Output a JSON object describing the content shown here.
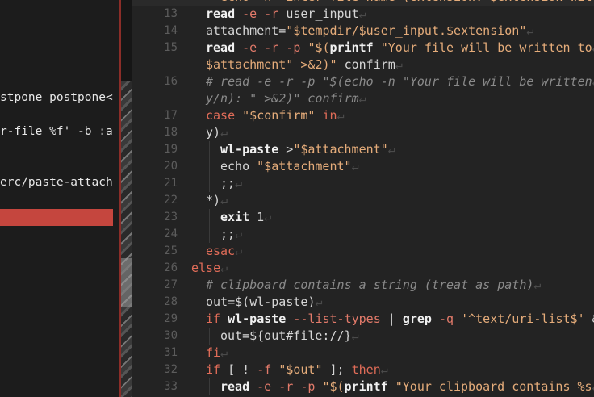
{
  "left_pane": {
    "lines": [
      {
        "text": "stpone postpone<"
      },
      {
        "text": "r-file %f' -b :a"
      },
      {
        "text": "erc/paste-attach"
      }
    ]
  },
  "editor": {
    "newline_glyph": "↵",
    "line_numbers": [
      "13",
      "14",
      "15",
      "16",
      "17",
      "18",
      "19",
      "20",
      "21",
      "22",
      "23",
      "24",
      "25",
      "26",
      "27",
      "28",
      "29",
      "30",
      "31",
      "32",
      "33"
    ],
    "top_partial_text": "echo -n \"Enter file name (extension: $extension will b",
    "lines": [
      {
        "num": "13",
        "tokens": [
          {
            "t": "read",
            "c": "fn"
          },
          {
            "t": " ",
            "c": ""
          },
          {
            "t": "-e",
            "c": "flag"
          },
          {
            "t": " ",
            "c": ""
          },
          {
            "t": "-r",
            "c": "flag"
          },
          {
            "t": " user_input",
            "c": ""
          }
        ]
      },
      {
        "num": "14",
        "tokens": [
          {
            "t": "attachment=",
            "c": ""
          },
          {
            "t": "\"",
            "c": "str"
          },
          {
            "t": "$tempdir",
            "c": "var"
          },
          {
            "t": "/",
            "c": "str"
          },
          {
            "t": "$user_input",
            "c": "var"
          },
          {
            "t": ".",
            "c": "str"
          },
          {
            "t": "$extension",
            "c": "var"
          },
          {
            "t": "\"",
            "c": "str"
          }
        ]
      },
      {
        "num": "15",
        "tokens": [
          {
            "t": "read",
            "c": "fn"
          },
          {
            "t": " ",
            "c": ""
          },
          {
            "t": "-e",
            "c": "flag"
          },
          {
            "t": " ",
            "c": ""
          },
          {
            "t": "-r",
            "c": "flag"
          },
          {
            "t": " ",
            "c": ""
          },
          {
            "t": "-p",
            "c": "flag"
          },
          {
            "t": " ",
            "c": ""
          },
          {
            "t": "\"$(",
            "c": "str"
          },
          {
            "t": "printf",
            "c": "fn"
          },
          {
            "t": " \"Your file will be written to",
            "c": "str"
          }
        ]
      },
      {
        "num": "",
        "tokens": [
          {
            "t": "$attachment\" >&2)\"",
            "c": "str"
          },
          {
            "t": " confirm",
            "c": ""
          }
        ]
      },
      {
        "num": "16",
        "tokens": [
          {
            "t": "# read -e -r -p \"$(echo -n \"Your file will be written",
            "c": "cmt"
          }
        ]
      },
      {
        "num": "",
        "tokens": [
          {
            "t": "y/n): \" >&2)\" confirm",
            "c": "cmt"
          }
        ]
      },
      {
        "num": "17",
        "tokens": [
          {
            "t": "case",
            "c": "kw"
          },
          {
            "t": " ",
            "c": ""
          },
          {
            "t": "\"$confirm\"",
            "c": "str"
          },
          {
            "t": " ",
            "c": ""
          },
          {
            "t": "in",
            "c": "kw"
          }
        ]
      },
      {
        "num": "18",
        "tokens": [
          {
            "t": "y)",
            "c": ""
          }
        ]
      },
      {
        "num": "19",
        "tokens": [
          {
            "t": "wl-paste",
            "c": "fn"
          },
          {
            "t": " >",
            "c": ""
          },
          {
            "t": "\"$attachment\"",
            "c": "str"
          }
        ]
      },
      {
        "num": "20",
        "tokens": [
          {
            "t": "echo",
            "c": ""
          },
          {
            "t": " ",
            "c": ""
          },
          {
            "t": "\"$attachment\"",
            "c": "str"
          }
        ]
      },
      {
        "num": "21",
        "tokens": [
          {
            "t": ";;",
            "c": ""
          }
        ]
      },
      {
        "num": "22",
        "tokens": [
          {
            "t": "*)",
            "c": ""
          }
        ]
      },
      {
        "num": "23",
        "tokens": [
          {
            "t": "exit",
            "c": "fn"
          },
          {
            "t": " 1",
            "c": ""
          }
        ]
      },
      {
        "num": "24",
        "tokens": [
          {
            "t": ";;",
            "c": ""
          }
        ]
      },
      {
        "num": "25",
        "tokens": [
          {
            "t": "esac",
            "c": "kw"
          }
        ]
      },
      {
        "num": "26",
        "tokens": [
          {
            "t": "else",
            "c": "kw"
          }
        ]
      },
      {
        "num": "27",
        "tokens": [
          {
            "t": "# clipboard contains a string (treat as path)",
            "c": "cmt"
          }
        ]
      },
      {
        "num": "28",
        "tokens": [
          {
            "t": "out=$(",
            "c": ""
          },
          {
            "t": "wl-paste",
            "c": ""
          },
          {
            "t": ")",
            "c": ""
          }
        ]
      },
      {
        "num": "29",
        "tokens": [
          {
            "t": "if",
            "c": "kw"
          },
          {
            "t": " ",
            "c": ""
          },
          {
            "t": "wl-paste",
            "c": "fn"
          },
          {
            "t": " ",
            "c": ""
          },
          {
            "t": "--list-types",
            "c": "flag"
          },
          {
            "t": " | ",
            "c": ""
          },
          {
            "t": "grep",
            "c": "fn"
          },
          {
            "t": " ",
            "c": ""
          },
          {
            "t": "-q",
            "c": "flag"
          },
          {
            "t": " ",
            "c": ""
          },
          {
            "t": "'^text/uri-list$'",
            "c": "str"
          },
          {
            "t": " &",
            "c": ""
          }
        ]
      },
      {
        "num": "30",
        "tokens": [
          {
            "t": "out=${out#file://}",
            "c": ""
          }
        ]
      },
      {
        "num": "31",
        "tokens": [
          {
            "t": "fi",
            "c": "kw"
          }
        ]
      },
      {
        "num": "32",
        "tokens": [
          {
            "t": "if",
            "c": "kw"
          },
          {
            "t": " [ ! ",
            "c": ""
          },
          {
            "t": "-f",
            "c": "flag"
          },
          {
            "t": " ",
            "c": ""
          },
          {
            "t": "\"$out\"",
            "c": "str"
          },
          {
            "t": " ]; ",
            "c": ""
          },
          {
            "t": "then",
            "c": "kw"
          }
        ]
      },
      {
        "num": "33",
        "tokens": [
          {
            "t": "read",
            "c": "fn"
          },
          {
            "t": " ",
            "c": ""
          },
          {
            "t": "-e",
            "c": "flag"
          },
          {
            "t": " ",
            "c": ""
          },
          {
            "t": "-r",
            "c": "flag"
          },
          {
            "t": " ",
            "c": ""
          },
          {
            "t": "-p",
            "c": "flag"
          },
          {
            "t": " ",
            "c": ""
          },
          {
            "t": "\"$(",
            "c": "str"
          },
          {
            "t": "printf",
            "c": "fn"
          },
          {
            "t": " \"Your clipboard contains %s",
            "c": "str"
          }
        ]
      }
    ]
  },
  "colors": {
    "background": "#232323",
    "error_bar": "#c5463e",
    "keyword": "#e06c58",
    "string": "#e5ac7a",
    "comment": "#8a8a8a"
  }
}
